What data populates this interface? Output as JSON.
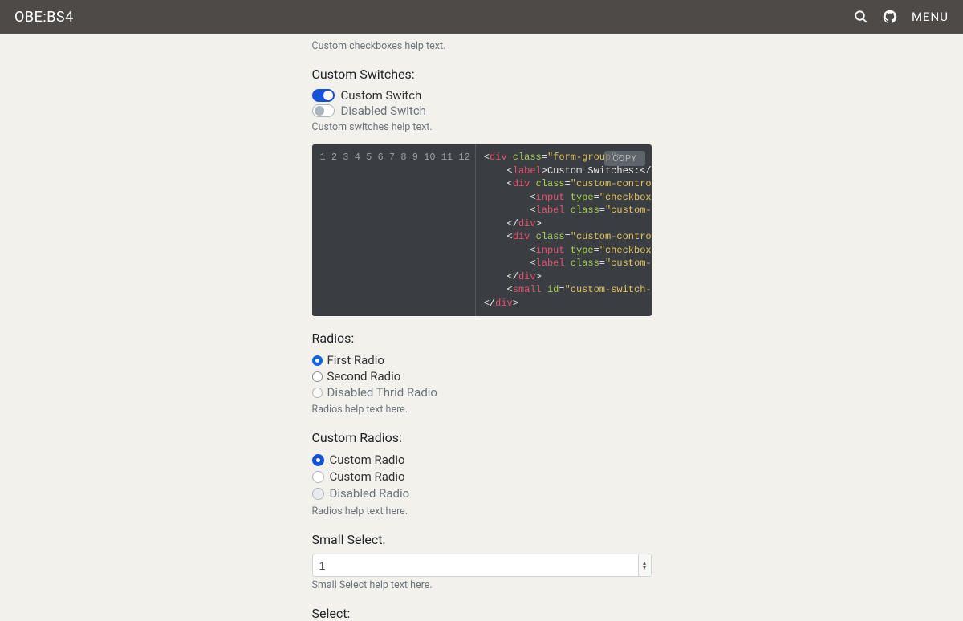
{
  "nav": {
    "brand": "OBE:BS4",
    "menu": "MENU"
  },
  "checkboxes_help": "Custom checkboxes help text.",
  "switches": {
    "label": "Custom Switches:",
    "items": [
      {
        "label": "Custom Switch",
        "on": true,
        "disabled": false
      },
      {
        "label": "Disabled Switch",
        "on": false,
        "disabled": true
      }
    ],
    "help": "Custom switches help text."
  },
  "code": {
    "copy": "COPY",
    "lines": 12
  },
  "radios": {
    "label": "Radios:",
    "items": [
      {
        "label": "First Radio",
        "checked": true,
        "disabled": false
      },
      {
        "label": "Second Radio",
        "checked": false,
        "disabled": false
      },
      {
        "label": "Disabled Thrid Radio",
        "checked": false,
        "disabled": true
      }
    ],
    "help": "Radios help text here."
  },
  "custom_radios": {
    "label": "Custom Radios:",
    "items": [
      {
        "label": "Custom Radio",
        "checked": true,
        "disabled": false
      },
      {
        "label": "Custom Radio",
        "checked": false,
        "disabled": false
      },
      {
        "label": "Disabled Radio",
        "checked": false,
        "disabled": true
      }
    ],
    "help": "Radios help text here."
  },
  "small_select": {
    "label": "Small Select:",
    "value": "1",
    "help": "Small Select help text here."
  },
  "select": {
    "label": "Select:"
  }
}
